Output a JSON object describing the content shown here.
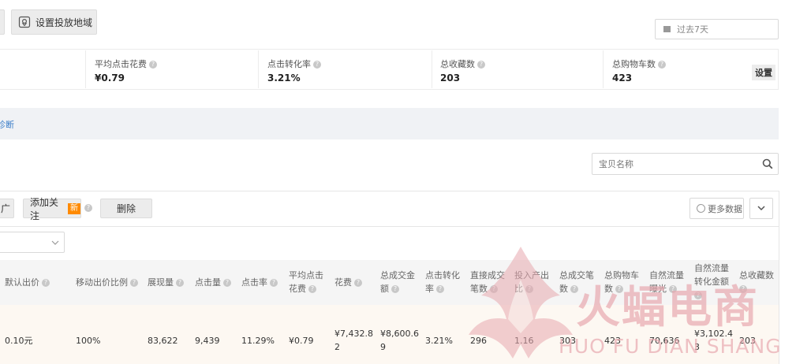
{
  "toolbar": {
    "region_button": "设置投放地域"
  },
  "date": {
    "label": "过去7天"
  },
  "metrics": [
    {
      "label": "平均点击花费",
      "value": "¥0.79"
    },
    {
      "label": "点击转化率",
      "value": "3.21%"
    },
    {
      "label": "总收藏数",
      "value": "203"
    },
    {
      "label": "总购物车数",
      "value": "423"
    }
  ],
  "metrics_settings": "设置",
  "diagnose": "诊断",
  "search": {
    "placeholder": "宝贝名称"
  },
  "actions": {
    "partial_label": "广",
    "add_follow": "添加关注",
    "new_badge": "新",
    "delete": "删除",
    "more_data": "更多数据"
  },
  "table": {
    "headers": [
      [
        "默认出价"
      ],
      [
        "移动出价比例"
      ],
      [
        "展现量"
      ],
      [
        "点击量"
      ],
      [
        "点击率"
      ],
      [
        "平均点击",
        "花费"
      ],
      [
        "花费"
      ],
      [
        "总成交金",
        "额"
      ],
      [
        "点击转化",
        "率"
      ],
      [
        "直接成交",
        "笔数"
      ],
      [
        "投入产出",
        "比"
      ],
      [
        "总成交笔",
        "数"
      ],
      [
        "总购物车",
        "数"
      ],
      [
        "自然流量",
        "曝光"
      ],
      [
        "自然流量",
        "转化金额"
      ],
      [
        "总收藏数"
      ]
    ],
    "row": [
      [
        "0.10元"
      ],
      [
        "100%"
      ],
      [
        "83,622"
      ],
      [
        "9,439"
      ],
      [
        "11.29%"
      ],
      [
        "¥0.79"
      ],
      [
        "¥7,432.8",
        "2"
      ],
      [
        "¥8,600.6",
        "9"
      ],
      [
        "3.21%"
      ],
      [
        "296"
      ],
      [
        "1.16"
      ],
      [
        "303"
      ],
      [
        "423"
      ],
      [
        "70,636"
      ],
      [
        "¥3,102.4",
        "3"
      ],
      [
        "203"
      ]
    ]
  },
  "watermark": {
    "cn": "火蝠电商",
    "en": "HUO FU DIAN SHANG",
    "color": "#e8a9b0"
  }
}
